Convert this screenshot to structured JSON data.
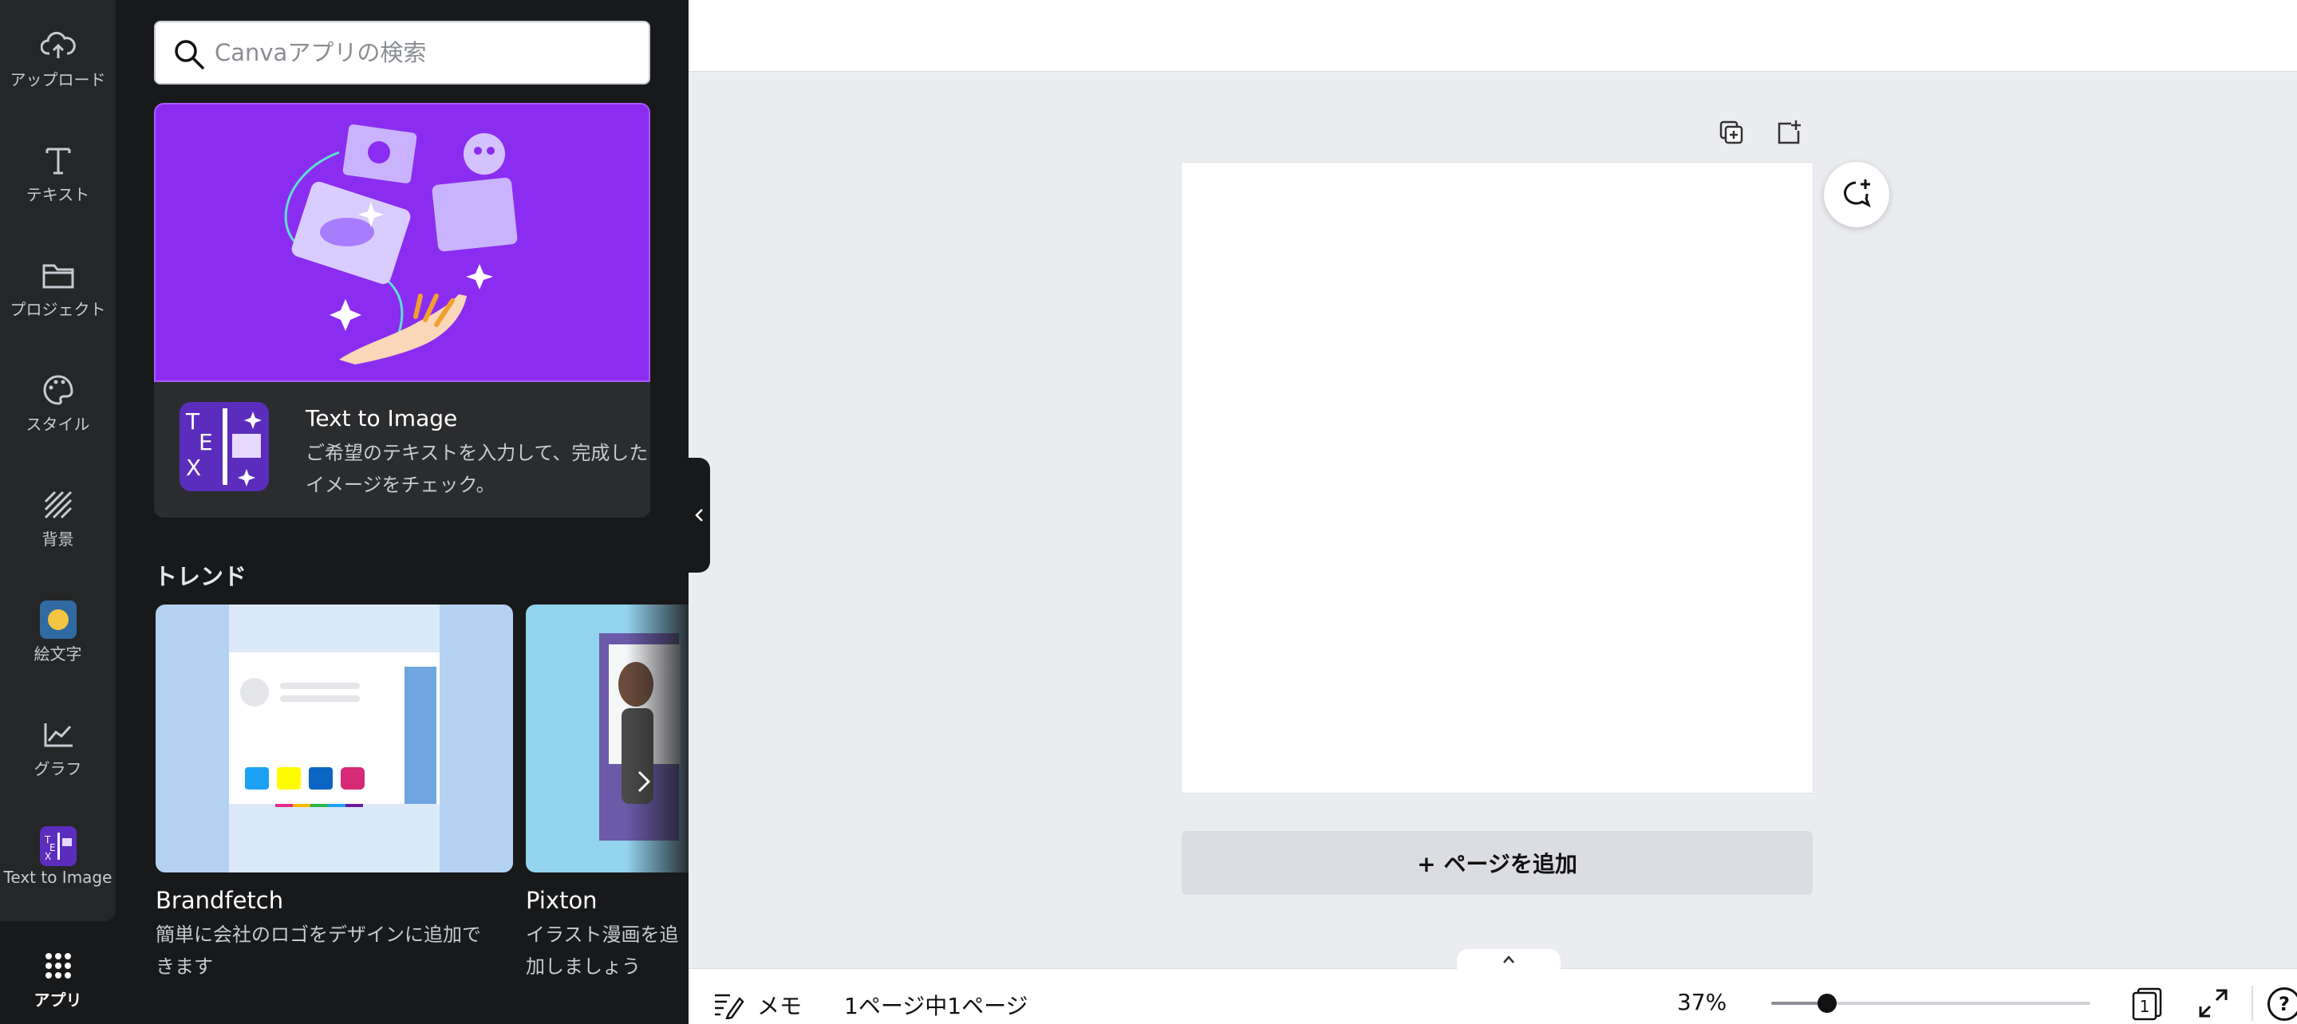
{
  "rail": {
    "items": [
      {
        "label": "アップロード",
        "icon": "cloud-upload-icon"
      },
      {
        "label": "テキスト",
        "icon": "text-t-icon"
      },
      {
        "label": "プロジェクト",
        "icon": "folder-icon"
      },
      {
        "label": "スタイル",
        "icon": "palette-icon"
      },
      {
        "label": "背景",
        "icon": "background-pattern-icon"
      },
      {
        "label": "絵文字",
        "icon": "emoji-icon"
      },
      {
        "label": "グラフ",
        "icon": "chart-line-icon"
      },
      {
        "label": "Text to Image",
        "icon": "text-to-image-app-icon"
      },
      {
        "label": "アプリ",
        "icon": "apps-grid-icon",
        "active": true
      }
    ]
  },
  "panel": {
    "search_placeholder": "Canvaアプリの検索",
    "featured": {
      "title": "Text to Image",
      "description": "ご希望のテキストを入力して、完成した\nイメージをチェック。"
    },
    "trend_heading": "トレンド",
    "trend_apps": [
      {
        "name": "Brandfetch",
        "description": "簡単に会社のロゴをデザインに追加できます"
      },
      {
        "name": "Pixton",
        "description": "イラスト漫画を追加しましょう"
      }
    ]
  },
  "editor": {
    "add_page_label": "+ ページを追加"
  },
  "bottombar": {
    "notes_label": "メモ",
    "page_count": "1ページ中1ページ",
    "zoom_label": "37%",
    "zoom_value": 0.37,
    "pages_badge": "1",
    "help_label": "?"
  },
  "colors": {
    "rail_bg": "#252627",
    "panel_bg": "#18191b",
    "feature_hero": "#8b2df0",
    "canvas_bg": "#ebecf0"
  }
}
